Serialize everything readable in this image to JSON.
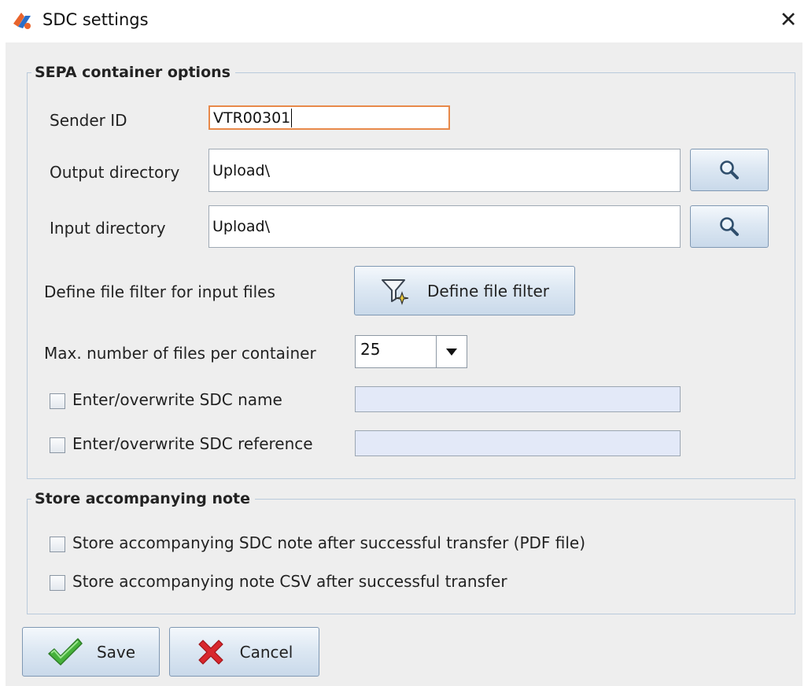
{
  "window": {
    "title": "SDC settings",
    "close_glyph": "✕",
    "icon": "app-logo-icon"
  },
  "sepa": {
    "legend": "SEPA container options",
    "sender_label": "Sender ID",
    "sender_value": "VTR00301",
    "output_label": "Output directory",
    "output_value": "Upload\\",
    "input_label": "Input directory",
    "input_value": "Upload\\",
    "filter_label": "Define file filter for input files",
    "filter_button": "Define file filter",
    "max_label": "Max. number of files per container",
    "max_value": "25",
    "sdc_name_label": "Enter/overwrite SDC name",
    "sdc_name_checked": false,
    "sdc_ref_label": "Enter/overwrite SDC reference",
    "sdc_ref_checked": false
  },
  "note": {
    "legend": "Store accompanying note",
    "pdf_label": "Store accompanying SDC note after successful transfer (PDF file)",
    "pdf_checked": false,
    "csv_label": "Store accompanying note CSV after successful transfer",
    "csv_checked": false
  },
  "buttons": {
    "save": "Save",
    "cancel": "Cancel"
  },
  "colors": {
    "focus_border": "#e8894a",
    "save_check": "#46b13b",
    "cancel_x": "#d8272d",
    "search_glass": "#2f4e6c"
  }
}
